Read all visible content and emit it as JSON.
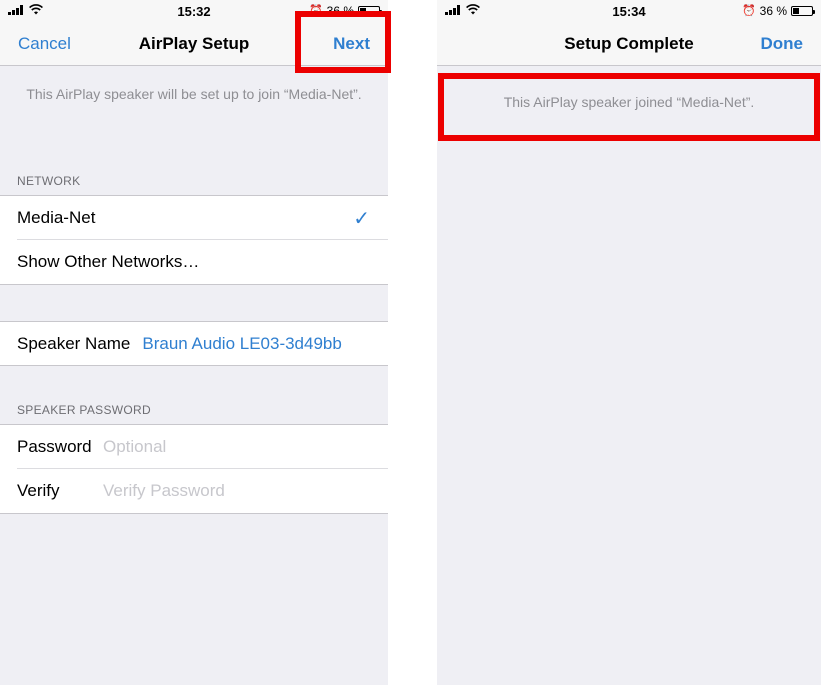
{
  "left_screen": {
    "status": {
      "time": "15:32",
      "battery": "36 %",
      "battery_level": 0.36
    },
    "nav": {
      "cancel": "Cancel",
      "title": "AirPlay Setup",
      "next": "Next"
    },
    "notice": "This AirPlay speaker will be set up to join “Media-Net”.",
    "network_header": "NETWORK",
    "networks": [
      {
        "label": "Media-Net",
        "checked": true
      },
      {
        "label": "Show Other Networks…"
      }
    ],
    "speaker_name": {
      "label": "Speaker Name",
      "value": "Braun Audio LE03-3d49bb"
    },
    "password_header": "SPEAKER PASSWORD",
    "password": {
      "label": "Password",
      "placeholder": "Optional"
    },
    "verify": {
      "label": "Verify",
      "placeholder": "Verify Password"
    }
  },
  "right_screen": {
    "status": {
      "time": "15:34",
      "battery": "36 %",
      "battery_level": 0.36
    },
    "nav": {
      "title": "Setup Complete",
      "done": "Done"
    },
    "notice": "This AirPlay speaker joined “Media-Net”."
  },
  "colors": {
    "accent": "#2f7fd0",
    "highlight": "#ec0000",
    "background": "#efeff4"
  },
  "icons": [
    "signal-icon",
    "wifi-icon",
    "alarm-icon",
    "battery-icon",
    "checkmark-icon"
  ]
}
